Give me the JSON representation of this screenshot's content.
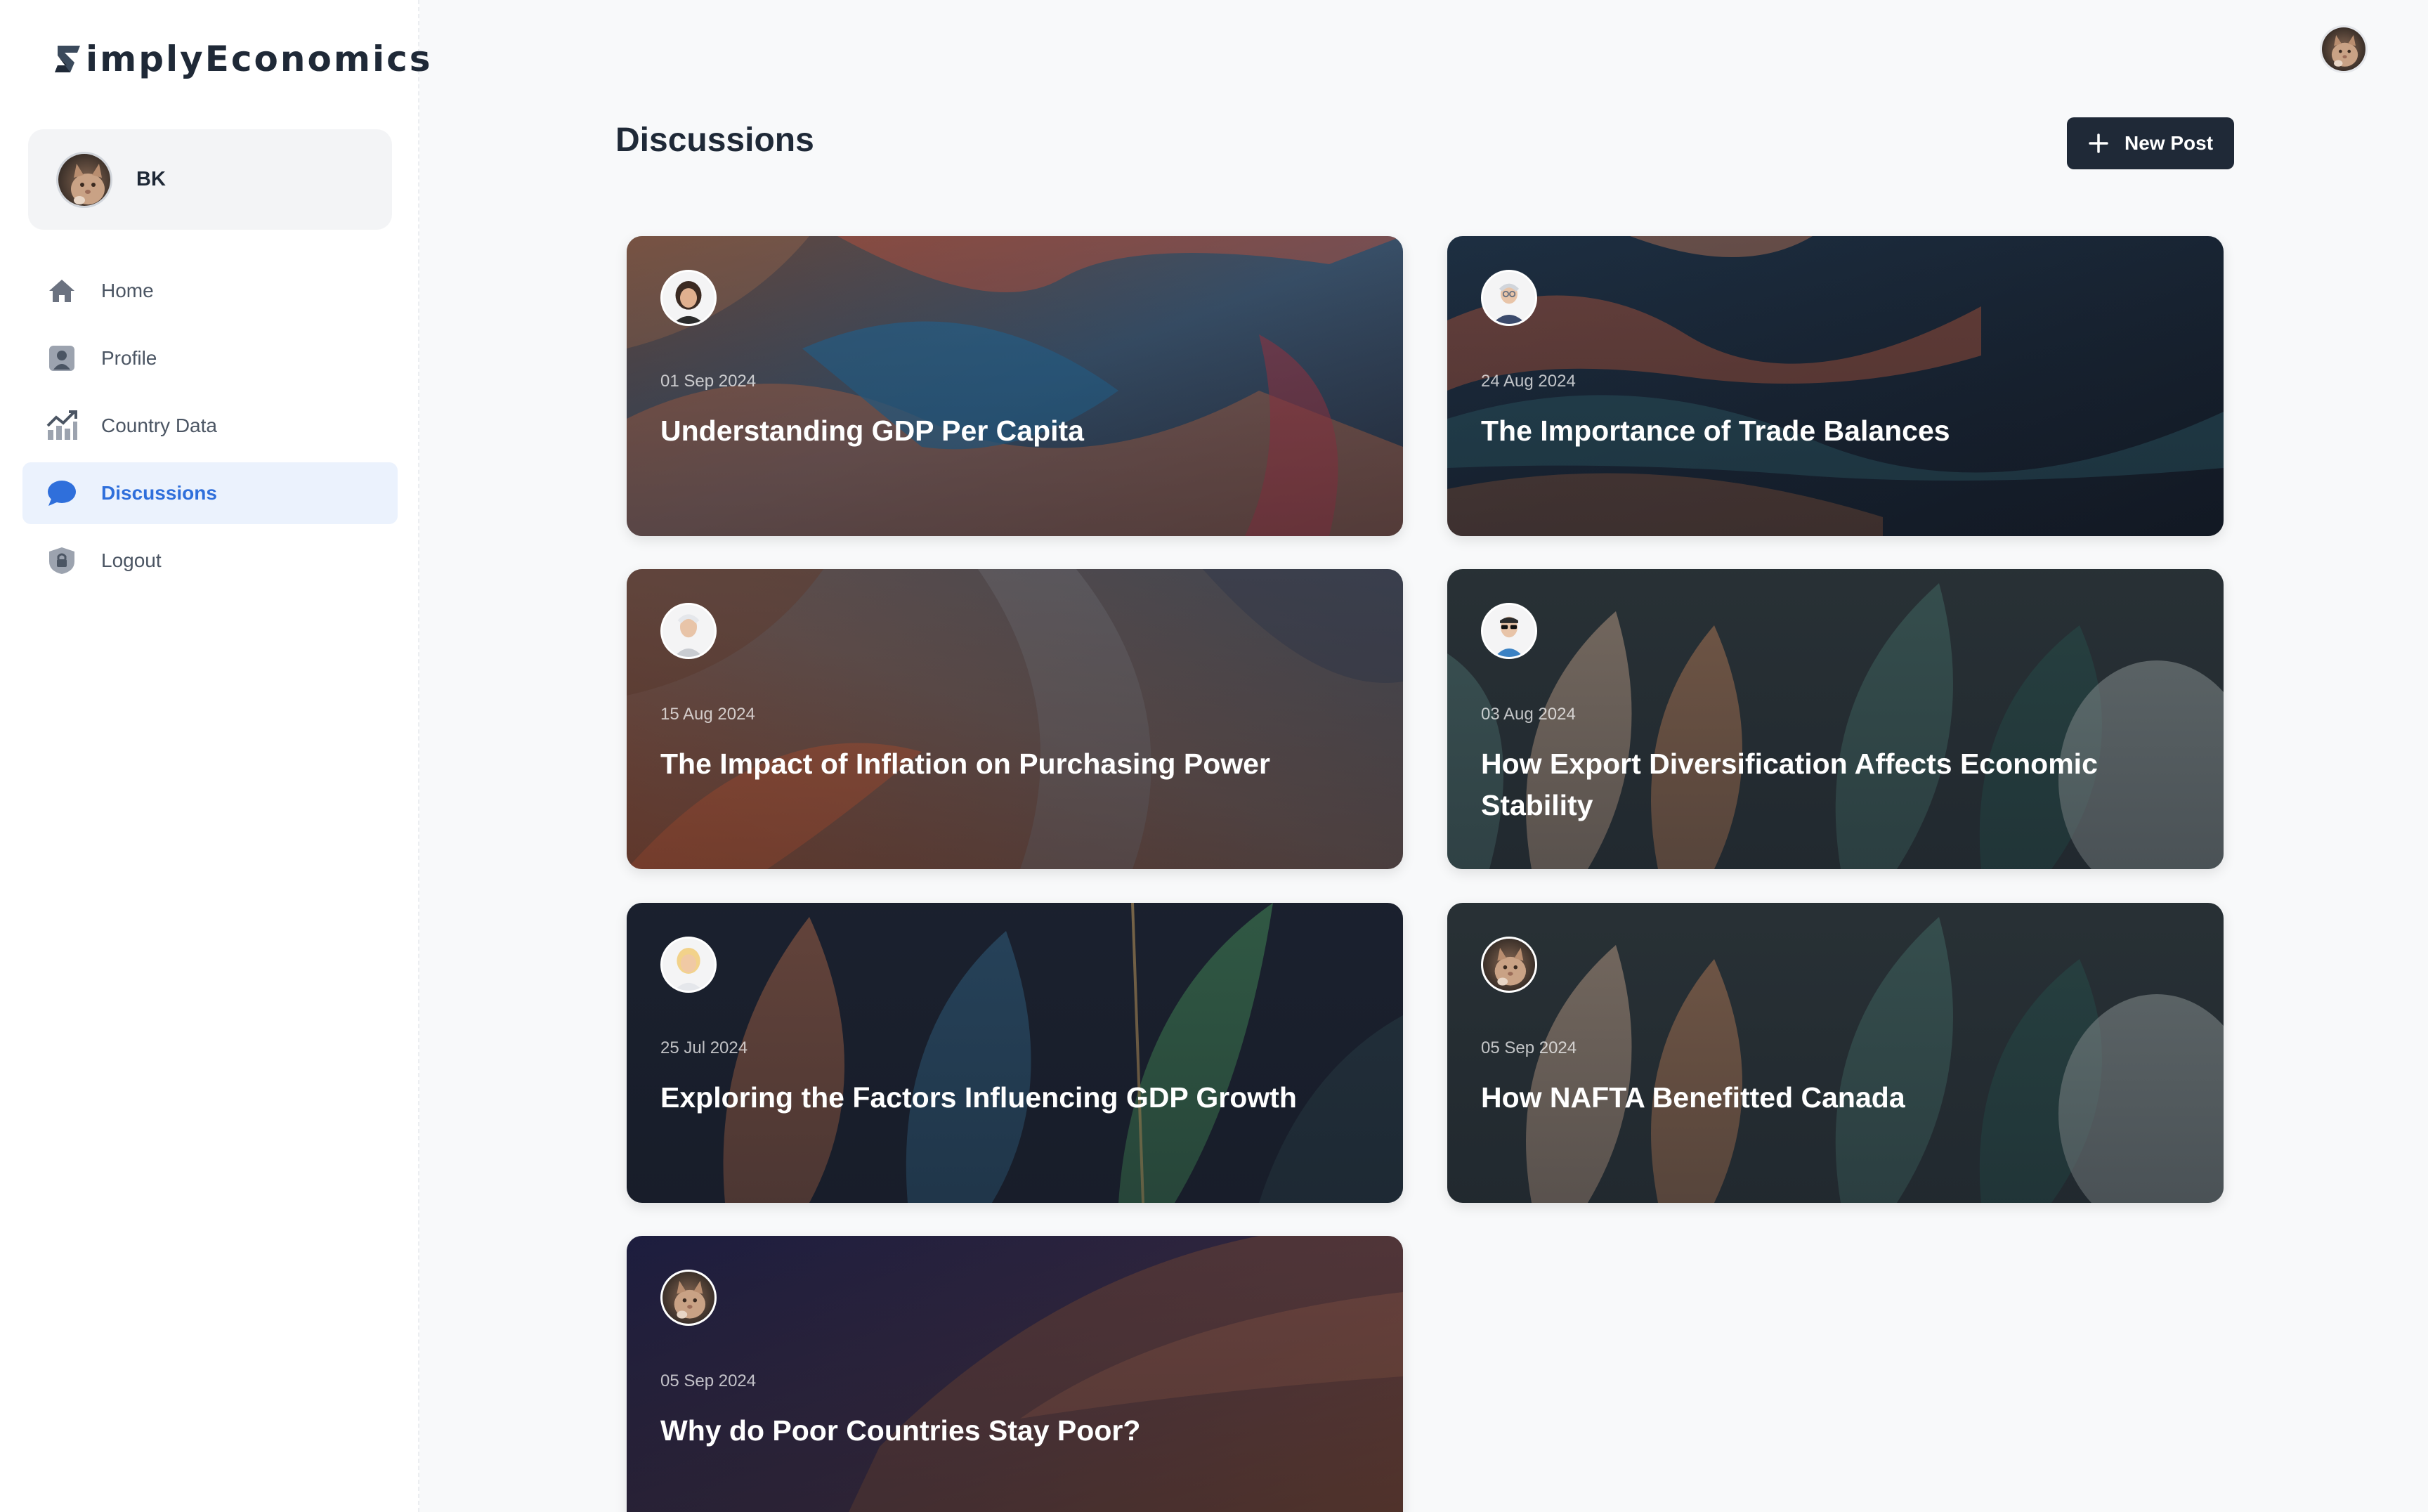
{
  "app": {
    "logo_text": "implyEconomics"
  },
  "user": {
    "name": "BK"
  },
  "sidebar": {
    "items": [
      {
        "label": "Home",
        "icon": "home-icon",
        "active": false
      },
      {
        "label": "Profile",
        "icon": "profile-icon",
        "active": false
      },
      {
        "label": "Country Data",
        "icon": "chart-icon",
        "active": false
      },
      {
        "label": "Discussions",
        "icon": "chat-bubble-icon",
        "active": true
      },
      {
        "label": "Logout",
        "icon": "lock-icon",
        "active": false
      }
    ]
  },
  "main": {
    "title": "Discussions",
    "new_post_label": "New Post"
  },
  "posts": [
    {
      "date": "01 Sep 2024",
      "title": "Understanding GDP Per Capita",
      "author_avatar": "woman-avatar"
    },
    {
      "date": "24 Aug 2024",
      "title": "The Importance of Trade Balances",
      "author_avatar": "older-man-avatar"
    },
    {
      "date": "15 Aug 2024",
      "title": "The Impact of Inflation on Purchasing Power",
      "author_avatar": "man-avatar"
    },
    {
      "date": "03 Aug 2024",
      "title": "How Export Diversification Affects Economic Stability",
      "author_avatar": "sunglasses-man-avatar"
    },
    {
      "date": "25 Jul 2024",
      "title": "Exploring the Factors Influencing GDP Growth",
      "author_avatar": "blonde-woman-avatar"
    },
    {
      "date": "05 Sep 2024",
      "title": "How NAFTA Benefitted Canada",
      "author_avatar": "cat-avatar"
    },
    {
      "date": "05 Sep 2024",
      "title": "Why do Poor Countries Stay Poor?",
      "author_avatar": "cat-avatar"
    }
  ],
  "colors": {
    "accent": "#2f6fdb",
    "active_bg": "#ebf2fd",
    "button_dark": "#1f2937",
    "page_bg": "#f8f9fa"
  }
}
